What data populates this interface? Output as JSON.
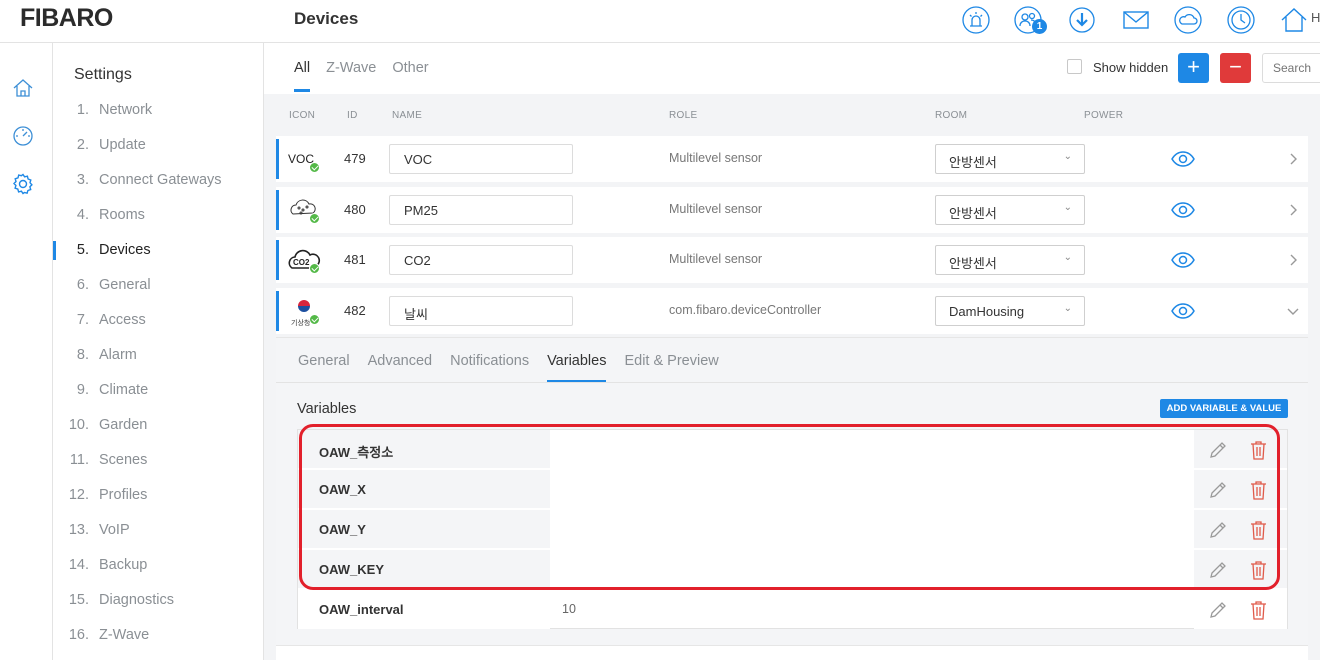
{
  "app": {
    "logo": "FIBARO",
    "page_title": "Devices",
    "home_label_cut": "H"
  },
  "header": {
    "notifications_badge": "1",
    "icons": [
      "alarm-icon",
      "users-icon",
      "download-icon",
      "mail-icon",
      "weather-icon",
      "clock-icon",
      "home-icon"
    ]
  },
  "rail": {
    "icons": [
      "home-icon",
      "dashboard-icon",
      "settings-icon"
    ]
  },
  "settings": {
    "title": "Settings",
    "items": [
      {
        "num": "1.",
        "label": "Network"
      },
      {
        "num": "2.",
        "label": "Update"
      },
      {
        "num": "3.",
        "label": "Connect Gateways"
      },
      {
        "num": "4.",
        "label": "Rooms"
      },
      {
        "num": "5.",
        "label": "Devices"
      },
      {
        "num": "6.",
        "label": "General"
      },
      {
        "num": "7.",
        "label": "Access"
      },
      {
        "num": "8.",
        "label": "Alarm"
      },
      {
        "num": "9.",
        "label": "Climate"
      },
      {
        "num": "10.",
        "label": "Garden"
      },
      {
        "num": "11.",
        "label": "Scenes"
      },
      {
        "num": "12.",
        "label": "Profiles"
      },
      {
        "num": "13.",
        "label": "VoIP"
      },
      {
        "num": "14.",
        "label": "Backup"
      },
      {
        "num": "15.",
        "label": "Diagnostics"
      },
      {
        "num": "16.",
        "label": "Z-Wave"
      }
    ],
    "active_index": 4
  },
  "filters": {
    "tabs": [
      "All",
      "Z-Wave",
      "Other"
    ],
    "show_hidden_label": "Show hidden",
    "add_label": "+",
    "remove_label": "−",
    "search_placeholder": "Search"
  },
  "table": {
    "columns": {
      "icon": "ICON",
      "id": "ID",
      "name": "NAME",
      "role": "ROLE",
      "room": "ROOM",
      "power": "POWER"
    },
    "rows": [
      {
        "icon_text": "VOC",
        "id": "479",
        "name": "VOC",
        "role": "Multilevel sensor",
        "room": "안방센서"
      },
      {
        "icon_text": "",
        "id": "480",
        "name": "PM25",
        "role": "Multilevel sensor",
        "room": "안방센서"
      },
      {
        "icon_text": "CO2",
        "id": "481",
        "name": "CO2",
        "role": "Multilevel sensor",
        "room": "안방센서"
      },
      {
        "icon_text": "기상청",
        "id": "482",
        "name": "날씨",
        "role": "com.fibaro.deviceController",
        "room": "DamHousing"
      }
    ]
  },
  "detail": {
    "tabs": [
      "General",
      "Advanced",
      "Notifications",
      "Variables",
      "Edit & Preview"
    ],
    "active_tab": "Variables",
    "variables_title": "Variables",
    "add_button": "ADD VARIABLE & VALUE",
    "variables": [
      {
        "name": "OAW_측정소",
        "value": ""
      },
      {
        "name": "OAW_X",
        "value": ""
      },
      {
        "name": "OAW_Y",
        "value": ""
      },
      {
        "name": "OAW_KEY",
        "value": ""
      },
      {
        "name": "OAW_interval",
        "value": "10"
      }
    ]
  },
  "colors": {
    "accent": "#1e88e5",
    "danger": "#e03a3a",
    "highlight": "#e2202b",
    "ok": "#54b948"
  }
}
